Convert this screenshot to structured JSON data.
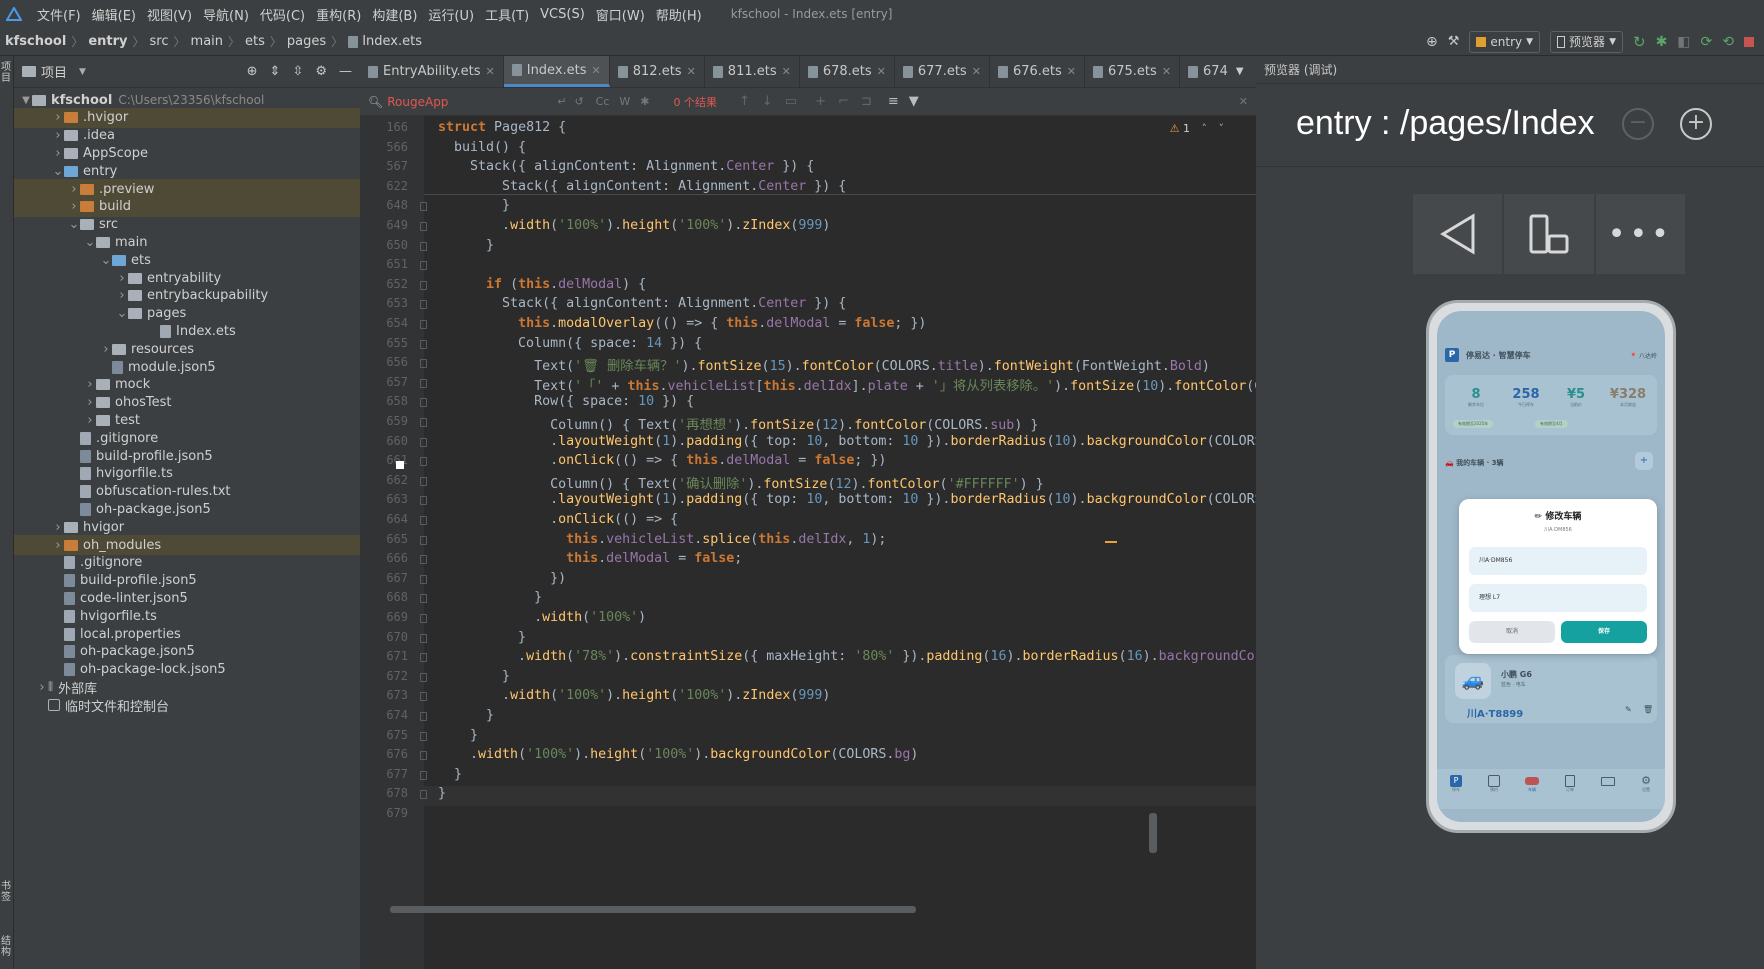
{
  "menu": [
    "文件(F)",
    "编辑(E)",
    "视图(V)",
    "导航(N)",
    "代码(C)",
    "重构(R)",
    "构建(B)",
    "运行(U)",
    "工具(T)",
    "VCS(S)",
    "窗口(W)",
    "帮助(H)"
  ],
  "window_title": "kfschool - Index.ets [entry]",
  "breadcrumb": [
    "kfschool",
    "entry",
    "src",
    "main",
    "ets",
    "pages",
    "Index.ets"
  ],
  "toolbar": {
    "module": "entry",
    "previewer": "预览器"
  },
  "project": {
    "header": "项目",
    "root_name": "kfschool",
    "root_path": "C:\\Users\\23356\\kfschool",
    "items": [
      {
        "label": ".hvigor"
      },
      {
        "label": ".idea"
      },
      {
        "label": "AppScope"
      },
      {
        "label": "entry"
      },
      {
        "label": ".preview"
      },
      {
        "label": "build"
      },
      {
        "label": "src"
      },
      {
        "label": "main"
      },
      {
        "label": "ets"
      },
      {
        "label": "entryability"
      },
      {
        "label": "entrybackupability"
      },
      {
        "label": "pages"
      },
      {
        "label": "Index.ets"
      },
      {
        "label": "resources"
      },
      {
        "label": "module.json5"
      },
      {
        "label": "mock"
      },
      {
        "label": "ohosTest"
      },
      {
        "label": "test"
      },
      {
        "label": ".gitignore"
      },
      {
        "label": "build-profile.json5"
      },
      {
        "label": "hvigorfile.ts"
      },
      {
        "label": "obfuscation-rules.txt"
      },
      {
        "label": "oh-package.json5"
      },
      {
        "label": "hvigor"
      },
      {
        "label": "oh_modules"
      },
      {
        "label": ".gitignore"
      },
      {
        "label": "build-profile.json5"
      },
      {
        "label": "code-linter.json5"
      },
      {
        "label": "hvigorfile.ts"
      },
      {
        "label": "local.properties"
      },
      {
        "label": "oh-package.json5"
      },
      {
        "label": "oh-package-lock.json5"
      },
      {
        "label": "外部库"
      },
      {
        "label": "临时文件和控制台"
      }
    ]
  },
  "left_strip": {
    "top": "项目",
    "bottom1": "书签",
    "bottom2": "结构"
  },
  "tabs": [
    "EntryAbility.ets",
    "Index.ets",
    "812.ets",
    "811.ets",
    "678.ets",
    "677.ets",
    "676.ets",
    "675.ets",
    "674"
  ],
  "find": {
    "query": "RougeApp",
    "results": "0 个结果",
    "case": "Cc",
    "word": "W"
  },
  "warnings": "1",
  "line_numbers": [
    "166",
    "566",
    "567",
    "622",
    "648",
    "649",
    "650",
    "651",
    "652",
    "653",
    "654",
    "655",
    "656",
    "657",
    "658",
    "659",
    "660",
    "661",
    "662",
    "663",
    "664",
    "665",
    "666",
    "667",
    "668",
    "669",
    "670",
    "671",
    "672",
    "673",
    "674",
    "675",
    "676",
    "677",
    "678",
    "679"
  ],
  "code_lines": [
    "struct Page812 {",
    "  build() {",
    "    Stack({ alignContent: Alignment.Center }) {",
    "        Stack({ alignContent: Alignment.Center }) {",
    "        }",
    "        .width('100%').height('100%').zIndex(999)",
    "      }",
    "",
    "      if (this.delModal) {",
    "        Stack({ alignContent: Alignment.Center }) {",
    "          this.modalOverlay(() => { this.delModal = false; })",
    "          Column({ space: 14 }) {",
    "            Text('🗑 删除车辆？').fontSize(15).fontColor(COLORS.title).fontWeight(FontWeight.Bold)",
    "            Text('「' + this.vehicleList[this.delIdx].plate + '」将从列表移除。').fontSize(10).fontColor(C",
    "            Row({ space: 10 }) {",
    "              Column() { Text('再想想').fontSize(12).fontColor(COLORS.sub) }",
    "              .layoutWeight(1).padding({ top: 10, bottom: 10 }).borderRadius(10).backgroundColor(COLORS",
    "              .onClick(() => { this.delModal = false; })",
    "              Column() { Text('确认删除').fontSize(12).fontColor('#FFFFFF') }",
    "              .layoutWeight(1).padding({ top: 10, bottom: 10 }).borderRadius(10).backgroundColor(COLORS",
    "              .onClick(() => {",
    "                this.vehicleList.splice(this.delIdx, 1);",
    "                this.delModal = false;",
    "              })",
    "            }",
    "            .width('100%')",
    "          }",
    "          .width('78%').constraintSize({ maxHeight: '80%' }).padding(16).borderRadius(16).backgroundCo",
    "        }",
    "        .width('100%').height('100%').zIndex(999)",
    "      }",
    "    }",
    "    .width('100%').height('100%').backgroundColor(COLORS.bg)",
    "  }",
    "}",
    ""
  ],
  "preview": {
    "title": "预览器 (调试)",
    "route": "entry : /pages/Index",
    "app": {
      "brand": "P",
      "name": "停易达 · 智慧停车",
      "loc": "📍 八达岭",
      "stats": [
        {
          "v": "8",
          "l": "剩余车位"
        },
        {
          "v": "258",
          "l": "今日停车"
        },
        {
          "v": "¥5",
          "l": "当前价"
        },
        {
          "v": "¥328",
          "l": "本月收益"
        }
      ],
      "chips": [
        "有效期至2025年",
        "有效期至4月"
      ],
      "section": "🚗 我的车辆 · 3辆",
      "modal": {
        "title": "✏ 修改车辆",
        "subtitle": "川A·DM856",
        "field1": "川A·DM856",
        "field2": "理想 L7",
        "cancel": "取消",
        "save": "保存"
      },
      "car_name": "小鹏 G6",
      "car_sub": "蓝色 · 电车",
      "plate": "川A·T8899",
      "nav": [
        "停车",
        "预约",
        "车辆",
        "订单",
        "设置"
      ]
    }
  },
  "colors": {
    "accent": "#4a88c7",
    "teal": "#14a19f",
    "keyword": "#cc7832",
    "string": "#6a8759"
  }
}
